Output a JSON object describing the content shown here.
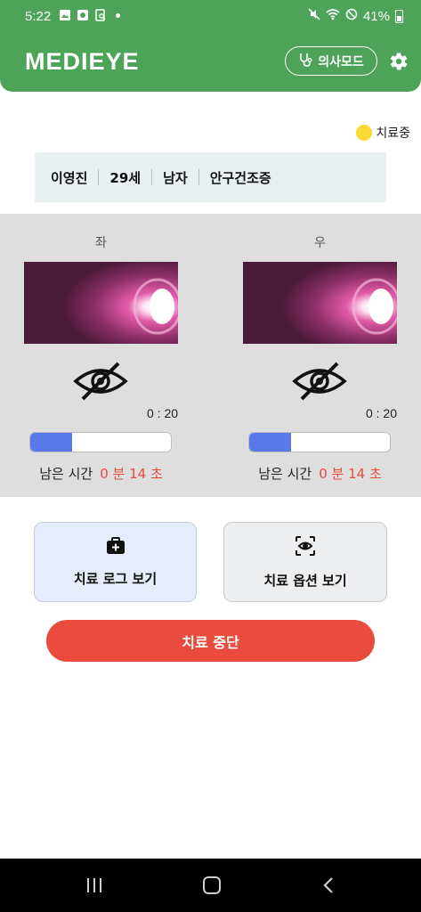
{
  "status_bar": {
    "time": "5:22",
    "battery": "41%"
  },
  "header": {
    "logo": "MEDIEYE",
    "doctor_mode_label": "의사모드",
    "colors": {
      "header_bg": "#4da458"
    }
  },
  "treatment_status": {
    "label": "치료중",
    "dot_color": "#fbd932"
  },
  "patient": {
    "name": "이영진",
    "age": "29세",
    "sex": "남자",
    "diagnosis": "안구건조증"
  },
  "eyes": {
    "left": {
      "label": "좌",
      "elapsed": "0 : 20",
      "progress_fraction": 0.3,
      "remaining_label": "남은 시간",
      "remaining_value": "0 분 14 초"
    },
    "right": {
      "label": "우",
      "elapsed": "0 : 20",
      "progress_fraction": 0.3,
      "remaining_label": "남은 시간",
      "remaining_value": "0 분 14 초"
    }
  },
  "actions": {
    "log_label": "치료 로그 보기",
    "options_label": "치료 옵션 보기",
    "stop_label": "치료 중단",
    "stop_color": "#e94b3c"
  },
  "icons": {
    "doctor": "stethoscope-icon",
    "settings": "gear-icon",
    "eye_off": "eye-slash-icon",
    "log": "medical-kit-icon",
    "options": "scan-eye-icon"
  }
}
